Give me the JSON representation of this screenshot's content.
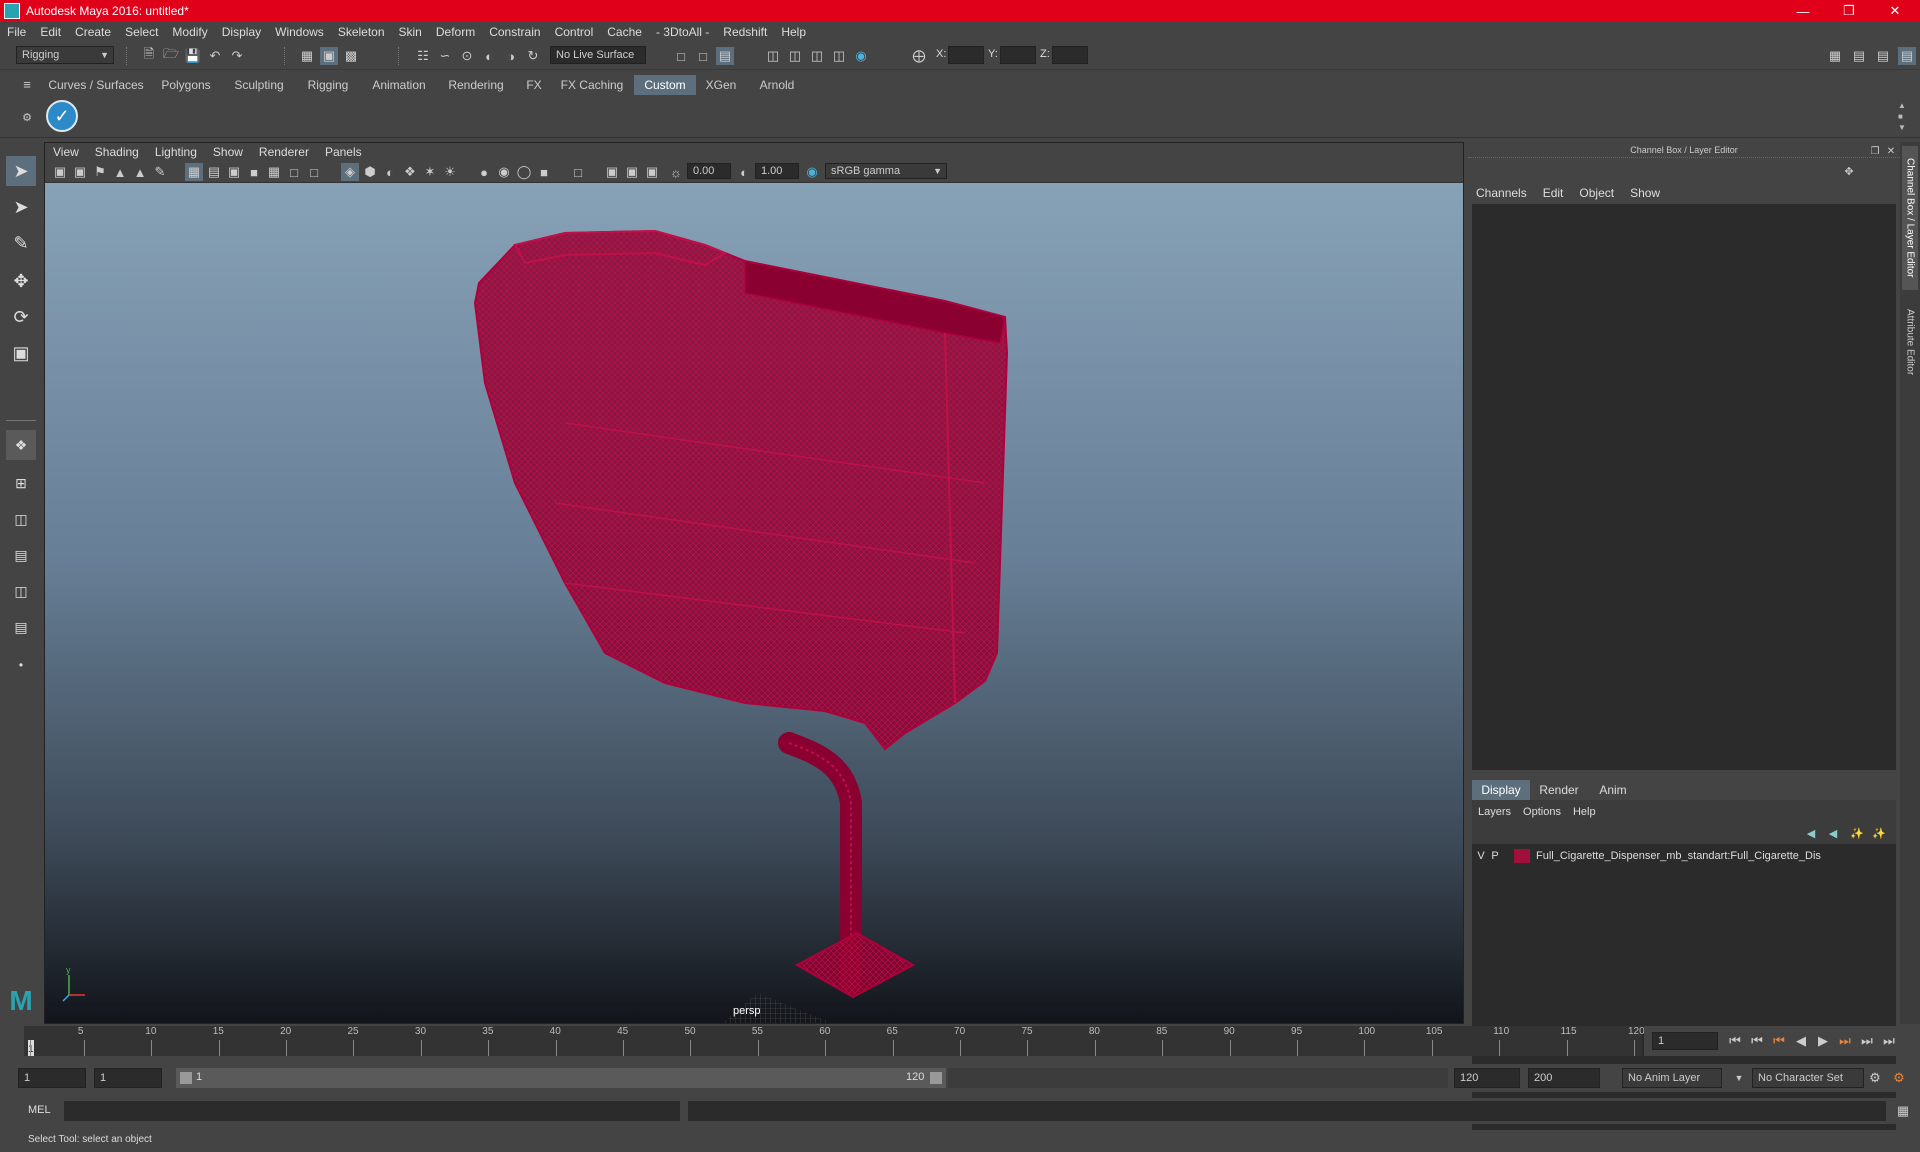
{
  "title": "Autodesk Maya 2016: untitled*",
  "menus": [
    "File",
    "Edit",
    "Create",
    "Select",
    "Modify",
    "Display",
    "Windows",
    "Skeleton",
    "Skin",
    "Deform",
    "Constrain",
    "Control",
    "Cache",
    "- 3DtoAll -",
    "Redshift",
    "Help"
  ],
  "status": {
    "mode": "Rigging",
    "live_surface": "No Live Surface",
    "x_label": "X:",
    "y_label": "Y:",
    "z_label": "Z:"
  },
  "shelf_tabs": [
    "Curves / Surfaces",
    "Polygons",
    "Sculpting",
    "Rigging",
    "Animation",
    "Rendering",
    "FX",
    "FX Caching",
    "Custom",
    "XGen",
    "Arnold"
  ],
  "active_shelf": "Custom",
  "viewport": {
    "menus": [
      "View",
      "Shading",
      "Lighting",
      "Show",
      "Renderer",
      "Panels"
    ],
    "exposure": "0.00",
    "gamma": "1.00",
    "color_space": "sRGB gamma",
    "camera": "persp",
    "wire_color": "#a0003a"
  },
  "channel_box": {
    "title": "Channel Box / Layer Editor",
    "menus": [
      "Channels",
      "Edit",
      "Object",
      "Show"
    ]
  },
  "layer_editor": {
    "tabs": [
      "Display",
      "Render",
      "Anim"
    ],
    "active_tab": "Display",
    "menus": [
      "Layers",
      "Options",
      "Help"
    ],
    "layers": [
      {
        "v": "V",
        "p": "P",
        "color": "#a0103a",
        "name": "Full_Cigarette_Dispenser_mb_standart:Full_Cigarette_Dis"
      }
    ]
  },
  "side_tabs": [
    "Channel Box / Layer Editor",
    "Attribute Editor"
  ],
  "timeline": {
    "ticks": [
      "1",
      "5",
      "10",
      "15",
      "20",
      "25",
      "30",
      "35",
      "40",
      "45",
      "50",
      "55",
      "60",
      "65",
      "70",
      "75",
      "80",
      "85",
      "90",
      "95",
      "100",
      "105",
      "110",
      "115",
      "120"
    ],
    "current_frame": "1"
  },
  "range": {
    "start": "1",
    "anim_start": "1",
    "slider_start": "1",
    "slider_end": "120",
    "anim_end": "120",
    "end": "200",
    "anim_layer": "No Anim Layer",
    "character_set": "No Character Set"
  },
  "command_line": {
    "label": "MEL"
  },
  "help_line": "Select Tool: select an object"
}
